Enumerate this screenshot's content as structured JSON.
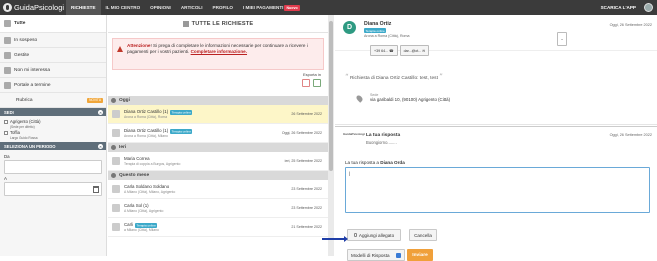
{
  "app": {
    "logo_text": "GuidaPsicologi"
  },
  "nav": {
    "items": [
      {
        "label": "RICHIESTE",
        "active": true
      },
      {
        "label": "IL MIO CENTRO"
      },
      {
        "label": "OPINIONI"
      },
      {
        "label": "ARTICOLI"
      },
      {
        "label": "PROFILO"
      },
      {
        "label": "I MIEI PAGAMENTI",
        "badge": "Nuovo"
      }
    ],
    "download_app": "SCARICA L'APP"
  },
  "sidebar": {
    "filters": [
      {
        "label": "Tutte",
        "active": true
      },
      {
        "label": "In sospeso"
      },
      {
        "label": "Gestite"
      },
      {
        "label": "Non mi interessa"
      },
      {
        "label": "Portale a termine"
      },
      {
        "label": "Rubrica",
        "badge": "NOVITÀ"
      }
    ],
    "sedi": {
      "title": "SEDI",
      "items": [
        {
          "label": "Agrigento (Città)",
          "sub": "(Sede per difetto)"
        },
        {
          "label": "Toffia",
          "sub": "Largo Guido Rossa"
        }
      ]
    },
    "period": {
      "title": "SELEZIONA UN PERIODO",
      "from_label": "Da",
      "to_label": "A"
    }
  },
  "middle": {
    "title": "TUTTE LE RICHIESTE",
    "alert": {
      "lead": "Attenzione",
      "text": "! Si prega di completare le informazioni necessarie per continuare a ricevere i pagamenti per i vostri pazienti.",
      "link": "Completare informazione."
    },
    "export_label": "Esporta in",
    "groups": [
      {
        "label": "Oggi",
        "items": [
          {
            "name": "Diana Ortiz Castillo (1)",
            "tag": "Terapia online",
            "sub": "Arona a Roma (Città), Roma",
            "date": "26 Settembre 2022",
            "selected": true
          },
          {
            "name": "Diana Ortiz Castillo (1)",
            "tag": "Terapia online",
            "sub": "Arona a Roma (Città), Milano",
            "date": "Oggi, 26 Settembre 2022"
          }
        ]
      },
      {
        "label": "Ieri",
        "items": [
          {
            "name": "Maria Correa",
            "sub": "Terapia di coppia a Burgos, Agrigento",
            "date": "ieri, 25 Settembre 2022"
          }
        ]
      },
      {
        "label": "Questo mese",
        "items": [
          {
            "name": "Carla Soldano Soldano",
            "sub": "A Milano (Città), Milano, Agrigento",
            "date": "23 Settembre 2022"
          },
          {
            "name": "Carla Sol (1)",
            "sub": "A Milano (Città), Agrigento",
            "date": "23 Settembre 2022"
          },
          {
            "name": "Carli",
            "tag": "Terapia online",
            "sub": "a Milano (Città), Milano",
            "date": "21 Settembre 2022"
          }
        ]
      }
    ]
  },
  "detail": {
    "avatar_letter": "D",
    "name": "Diana Ortiz",
    "tag": "Terapia online",
    "address": "Arona a Roma (Città), Roma",
    "phone_btn": "+39 64...",
    "email_btn": "dar...@ot...",
    "date": "Oggi, 26 Settembre 2022",
    "request": "Richiesta di Diana Ortiz Castillo: test, test",
    "place_label": "Sede",
    "place_value": "via garibaldi 10, (90100) Agrigento (Città)"
  },
  "reply": {
    "logo_text": "GuidaPsicologi",
    "header": "La tua risposta",
    "greeting": "Buongiorno........",
    "date": "Oggi, 26 Settembre 2022",
    "label_prefix": "La tua risposta a",
    "label_name": "Diana Orda",
    "textarea_value": "|",
    "attach_label": "Aggiungi allegato",
    "cancel_label": "Cancella",
    "templates_label": "Modelli di Risposta",
    "send_label": "Inviare"
  }
}
